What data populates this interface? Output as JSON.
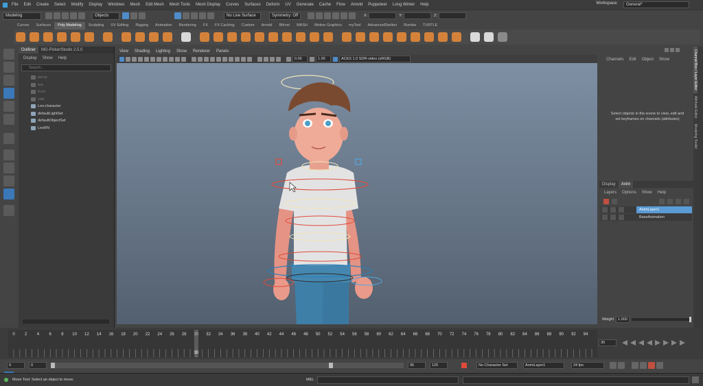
{
  "menubar": {
    "items": [
      "File",
      "Edit",
      "Create",
      "Select",
      "Modify",
      "Display",
      "Windows",
      "Mesh",
      "Edit Mesh",
      "Mesh Tools",
      "Mesh Display",
      "Curves",
      "Surfaces",
      "Deform",
      "UV",
      "Generate",
      "Cache",
      "Flow",
      "Arnold",
      "Puppeteer",
      "Long Winter",
      "Help"
    ],
    "workspace_label": "Workspace:",
    "workspace_value": "General*"
  },
  "statusline": {
    "menuset": "Modeling",
    "objects": "Objects",
    "live_surface": "No Live Surface",
    "symmetry": "Symmetry: Off",
    "x_label": "X:",
    "y_label": "Y:",
    "z_label": "Z:"
  },
  "shelf": {
    "tabs": [
      "Curves",
      "Surfaces",
      "Poly Modeling",
      "Sculpting",
      "UV Editing",
      "Rigging",
      "Animation",
      "Rendering",
      "FX",
      "FX Caching",
      "Custom",
      "Arnold",
      "Bifrost",
      "MASH",
      "Motion Graphics",
      "myTool",
      "AdvancedSkelton",
      "Rumba",
      "TURTLE"
    ],
    "active_tab": "Poly Modeling"
  },
  "outliner": {
    "tabs": [
      "Outliner",
      "MG-PickerStudio 2.5.0"
    ],
    "menus": [
      "Display",
      "Show",
      "Help"
    ],
    "search_placeholder": "Search...",
    "items": [
      {
        "label": "persp",
        "dim": true
      },
      {
        "label": "top",
        "dim": true
      },
      {
        "label": "front",
        "dim": true
      },
      {
        "label": "side",
        "dim": true
      },
      {
        "label": "Leo:character",
        "dim": false
      },
      {
        "label": "defaultLightSet",
        "dim": false
      },
      {
        "label": "defaultObjectSet",
        "dim": false
      },
      {
        "label": "LeoRN",
        "dim": false
      }
    ]
  },
  "viewport": {
    "menus": [
      "View",
      "Shading",
      "Lighting",
      "Show",
      "Renderer",
      "Panels"
    ],
    "value_a": "0.00",
    "value_b": "1.00",
    "colorspace": "ACES 1.0 SDR-video (sRGB)"
  },
  "channelbox": {
    "menus": [
      "Channels",
      "Edit",
      "Object",
      "Show"
    ],
    "hint": "Select objects in the scene to view, edit and set keyframes on channels (attributes)"
  },
  "sidetabs": [
    "Channel Box / Layer Editor",
    "Attribute Editor",
    "Modeling Toolkit"
  ],
  "layereditor": {
    "tabs": [
      "Display",
      "Anim"
    ],
    "active_tab": "Anim",
    "menus": [
      "Layers",
      "Options",
      "Show",
      "Help"
    ],
    "layers": [
      {
        "name": "AnimLayer1",
        "selected": true
      },
      {
        "name": "BaseAnimation",
        "selected": false
      }
    ],
    "weight_label": "Weight",
    "weight_value": "1.000"
  },
  "timeline": {
    "ticks": [
      "0",
      "2",
      "4",
      "6",
      "8",
      "10",
      "12",
      "14",
      "16",
      "18",
      "20",
      "22",
      "24",
      "26",
      "28",
      "30",
      "32",
      "34",
      "36",
      "38",
      "40",
      "42",
      "44",
      "46",
      "48",
      "50",
      "52",
      "54",
      "56",
      "58",
      "60",
      "62",
      "64",
      "66",
      "68",
      "70",
      "72",
      "74",
      "76",
      "78",
      "80",
      "82",
      "84",
      "86",
      "88",
      "90",
      "92",
      "94"
    ],
    "current_frame": "30",
    "current_frame_field": "30"
  },
  "range": {
    "start": "0",
    "anim_start": "0",
    "end": "95",
    "anim_end": "120",
    "character": "No Character Set",
    "anim_layer": "AnimLayer1",
    "fps": "24 fps"
  },
  "helpline": {
    "message": "Move Tool: Select an object to move.",
    "mel_label": "MEL"
  },
  "colors": {
    "accent": "#4f8cc9",
    "shelf_orange": "#d4823a",
    "layer_selected": "#5a9bd5"
  }
}
